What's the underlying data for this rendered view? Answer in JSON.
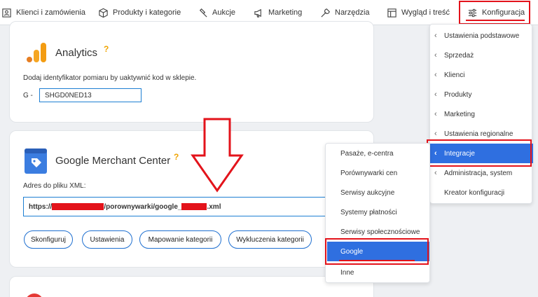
{
  "nav": {
    "items": [
      {
        "label": "Klienci i zamówienia",
        "icon": "user-icon"
      },
      {
        "label": "Produkty i kategorie",
        "icon": "box-icon"
      },
      {
        "label": "Aukcje",
        "icon": "hammer-icon"
      },
      {
        "label": "Marketing",
        "icon": "megaphone-icon"
      },
      {
        "label": "Narzędzia",
        "icon": "wrench-icon"
      },
      {
        "label": "Wygląd i treść",
        "icon": "layout-icon"
      },
      {
        "label": "Konfiguracja",
        "icon": "sliders-icon"
      }
    ]
  },
  "analytics": {
    "title": "Analytics",
    "help": "?",
    "description": "Dodaj identyfikator pomiaru by uaktywnić kod w sklepie.",
    "prefix": "G -",
    "measurement_id": "SHGD0NED13"
  },
  "gmc": {
    "title": "Google Merchant Center",
    "help": "?",
    "xml_label": "Adres do pliku XML:",
    "url_start": "https://",
    "url_middle": "/porownywarki/google_",
    "url_end": ".xml",
    "buttons": [
      "Skonfiguruj",
      "Ustawienia",
      "Mapowanie kategorii",
      "Wykluczenia kategorii"
    ]
  },
  "config_menu": {
    "items": [
      {
        "label": "Ustawienia podstawowe",
        "chevron": true
      },
      {
        "label": "Sprzedaż",
        "chevron": true
      },
      {
        "label": "Klienci",
        "chevron": true
      },
      {
        "label": "Produkty",
        "chevron": true
      },
      {
        "label": "Marketing",
        "chevron": true
      },
      {
        "label": "Ustawienia regionalne",
        "chevron": true
      },
      {
        "label": "Integracje",
        "chevron": true,
        "active": true
      },
      {
        "label": "Administracja, system",
        "chevron": true
      },
      {
        "label": "Kreator konfiguracji",
        "chevron": false
      }
    ]
  },
  "integrations_menu": {
    "items": [
      {
        "label": "Pasaże, e-centra"
      },
      {
        "label": "Porównywarki cen"
      },
      {
        "label": "Serwisy aukcyjne"
      },
      {
        "label": "Systemy płatności"
      },
      {
        "label": "Serwisy społecznościowe"
      },
      {
        "label": "Google",
        "active": true
      },
      {
        "label": "Inne"
      }
    ]
  },
  "colors": {
    "accent": "#2f6fe0",
    "highlight": "#e3131b",
    "analytics_orange": "#f39c12"
  }
}
